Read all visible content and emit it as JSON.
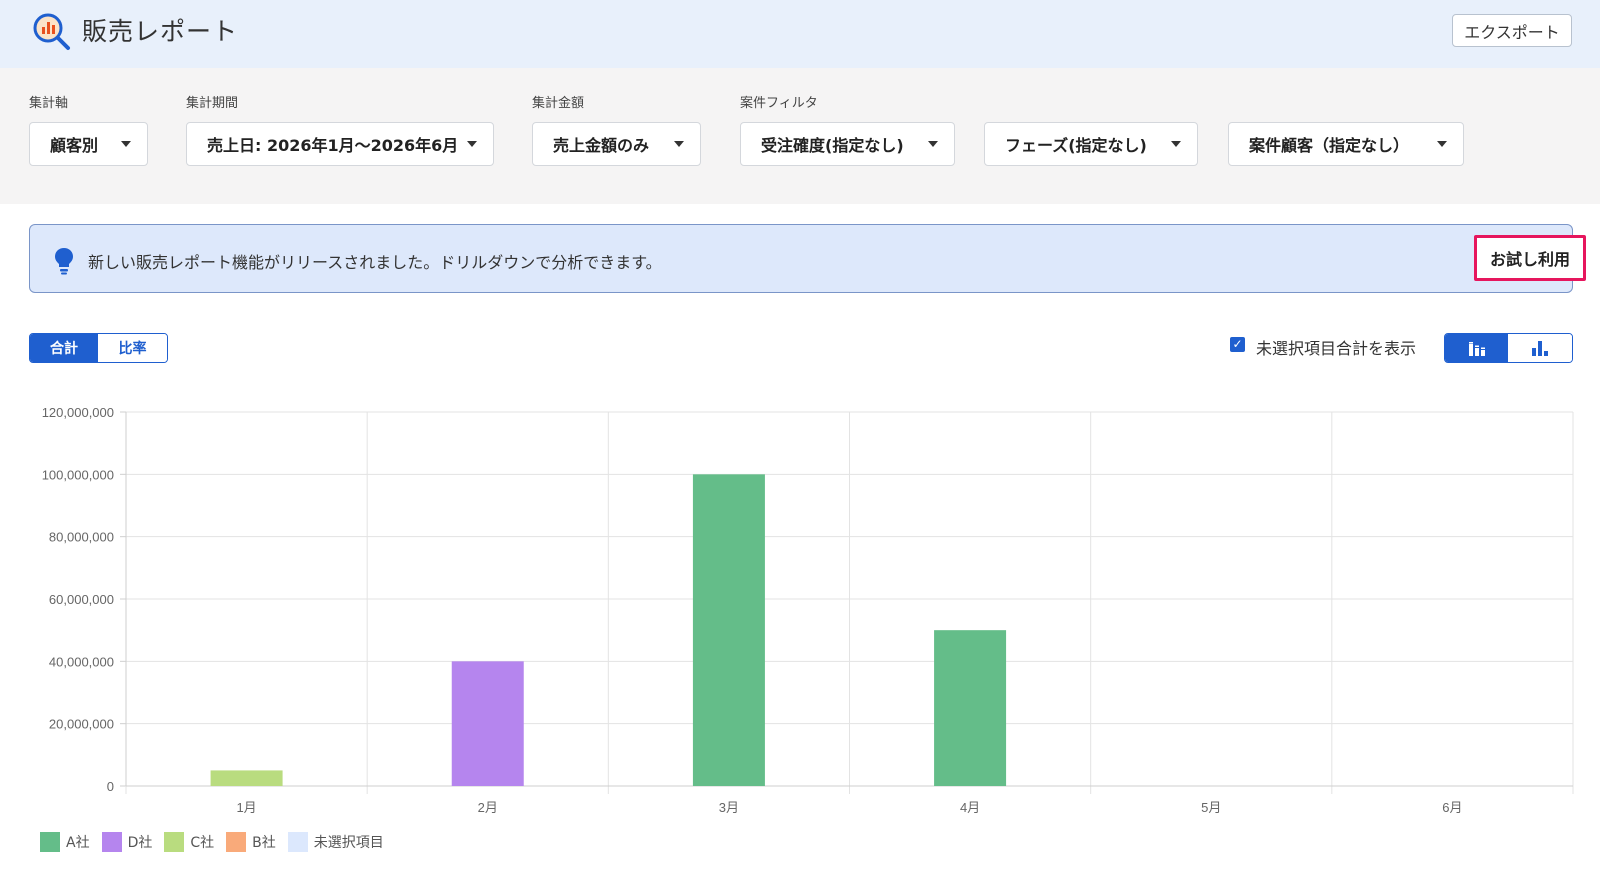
{
  "header": {
    "title": "販売レポート",
    "export_label": "エクスポート"
  },
  "filters": {
    "axis": {
      "label": "集計軸",
      "value": "顧客別"
    },
    "period": {
      "label": "集計期間",
      "value": "売上日: 2026年1月～2026年6月"
    },
    "amount": {
      "label": "集計金額",
      "value": "売上金額のみ"
    },
    "case_filter": {
      "label": "案件フィルタ",
      "order": "受注確度(指定なし)",
      "phase": "フェーズ(指定なし)",
      "customer": "案件顧客（指定なし）"
    }
  },
  "notice": {
    "message": "新しい販売レポート機能がリリースされました。ドリルダウンで分析できます。",
    "trial_label": "お試し利用"
  },
  "view_toggle": {
    "total_label": "合計",
    "ratio_label": "比率",
    "selected": "合計"
  },
  "show_unselected": {
    "label": "未選択項目合計を表示",
    "checked": true
  },
  "chart_type_toggle": {
    "selected": "stacked"
  },
  "colors": {
    "accent": "#1f5fcf",
    "highlight": "#e6165d"
  },
  "chart_data": {
    "type": "bar",
    "stacked": true,
    "categories": [
      "1月",
      "2月",
      "3月",
      "4月",
      "5月",
      "6月"
    ],
    "series": [
      {
        "name": "A社",
        "color": "#64bd89",
        "values": [
          0,
          0,
          100000000,
          50000000,
          0,
          0
        ]
      },
      {
        "name": "D社",
        "color": "#b585ee",
        "values": [
          0,
          40000000,
          0,
          0,
          0,
          0
        ]
      },
      {
        "name": "C社",
        "color": "#b9dc7f",
        "values": [
          5000000,
          0,
          0,
          0,
          0,
          0
        ]
      },
      {
        "name": "B社",
        "color": "#f9aa7a",
        "values": [
          0,
          0,
          0,
          0,
          0,
          0
        ]
      },
      {
        "name": "未選択項目",
        "color": "#dce8fd",
        "values": [
          0,
          0,
          0,
          0,
          0,
          0
        ]
      }
    ],
    "ylim": [
      0,
      120000000
    ],
    "yticks": [
      "0",
      "20,000,000",
      "40,000,000",
      "60,000,000",
      "80,000,000",
      "100,000,000",
      "120,000,000"
    ],
    "grid": true,
    "legend_position": "bottom-left"
  }
}
